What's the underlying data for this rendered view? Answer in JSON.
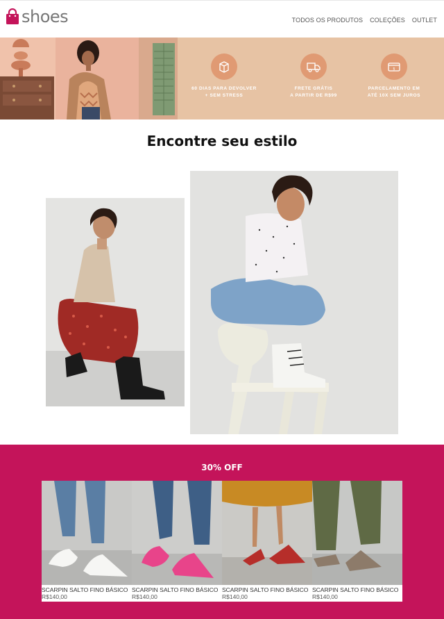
{
  "header": {
    "logo_text": "shoes",
    "nav": [
      "TODOS OS PRODUTOS",
      "COLEÇÕES",
      "OUTLET"
    ]
  },
  "banner": {
    "perks": [
      {
        "line1": "60 DIAS PARA DEVOLVER",
        "line2": "+ SEM STRESS",
        "icon": "return-box-icon"
      },
      {
        "line1": "FRETE GRÁTIS",
        "line2": "A PARTIR DE R$99",
        "icon": "delivery-truck-icon"
      },
      {
        "line1": "PARCELAMENTO EM",
        "line2": "ATÉ 10X SEM JUROS",
        "icon": "credit-card-icon"
      }
    ]
  },
  "style_section": {
    "title": "Encontre seu estilo"
  },
  "promo": {
    "title": "30% OFF",
    "products": [
      {
        "name": "SCARPIN SALTO FINO BÁSICO",
        "price": "R$140,00"
      },
      {
        "name": "SCARPIN SALTO FINO BÁSICO",
        "price": "R$140,00"
      },
      {
        "name": "SCARPIN SALTO FINO BÁSICO",
        "price": "R$140,00"
      },
      {
        "name": "SCARPIN SALTO FINO BÁSICO",
        "price": "R$140,00"
      }
    ]
  },
  "colors": {
    "brand": "#c4145a",
    "banner_bg": "#e7c3a4",
    "perk_icon_bg": "#e09a73"
  }
}
